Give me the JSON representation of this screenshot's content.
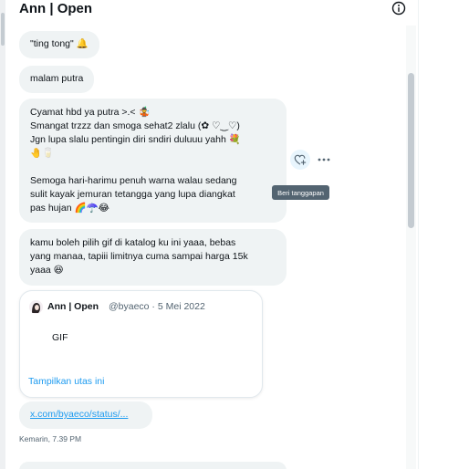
{
  "header": {
    "title": "Ann | Open",
    "info_icon": "info-icon"
  },
  "messages": [
    {
      "text": "\"ting tong\" 🔔"
    },
    {
      "text": "malam putra"
    },
    {
      "lines": [
        "Cyamat hbd ya putra >.< 🤹",
        "Smangat trzzz dan smoga sehat2 zlalu (✿ ♡‿♡)",
        "Jgn lupa slalu pentingin diri sndiri duluuu yahh 💐",
        "🤚🥛",
        "",
        "Semoga hari-harimu penuh warna walau sedang",
        "sulit kayak jemuran tetangga yang lupa diangkat",
        "pas hujan 🌈☂️😂"
      ]
    },
    {
      "lines": [
        "kamu boleh pilih gif di katalog ku ini yaaa, bebas",
        "yang manaa, tapiii limitnya cuma sampai harga 15k",
        "yaaa 😆"
      ]
    }
  ],
  "actions": {
    "react_icon": "heart-plus-icon",
    "more_icon": "more-icon",
    "tooltip": "Beri tanggapan"
  },
  "quote": {
    "name": "Ann | Open",
    "handle": "@byaeco · 5 Mei 2022",
    "body": "GIF",
    "show_thread": "Tampilkan utas ini"
  },
  "link": {
    "text": "x.com/byaeco/status/..."
  },
  "timestamp": "Kemarin, 7.39 PM",
  "colors": {
    "bubble": "#eff3f4",
    "link": "#1d9bf0",
    "muted": "#536471",
    "tooltip": "#536471"
  }
}
